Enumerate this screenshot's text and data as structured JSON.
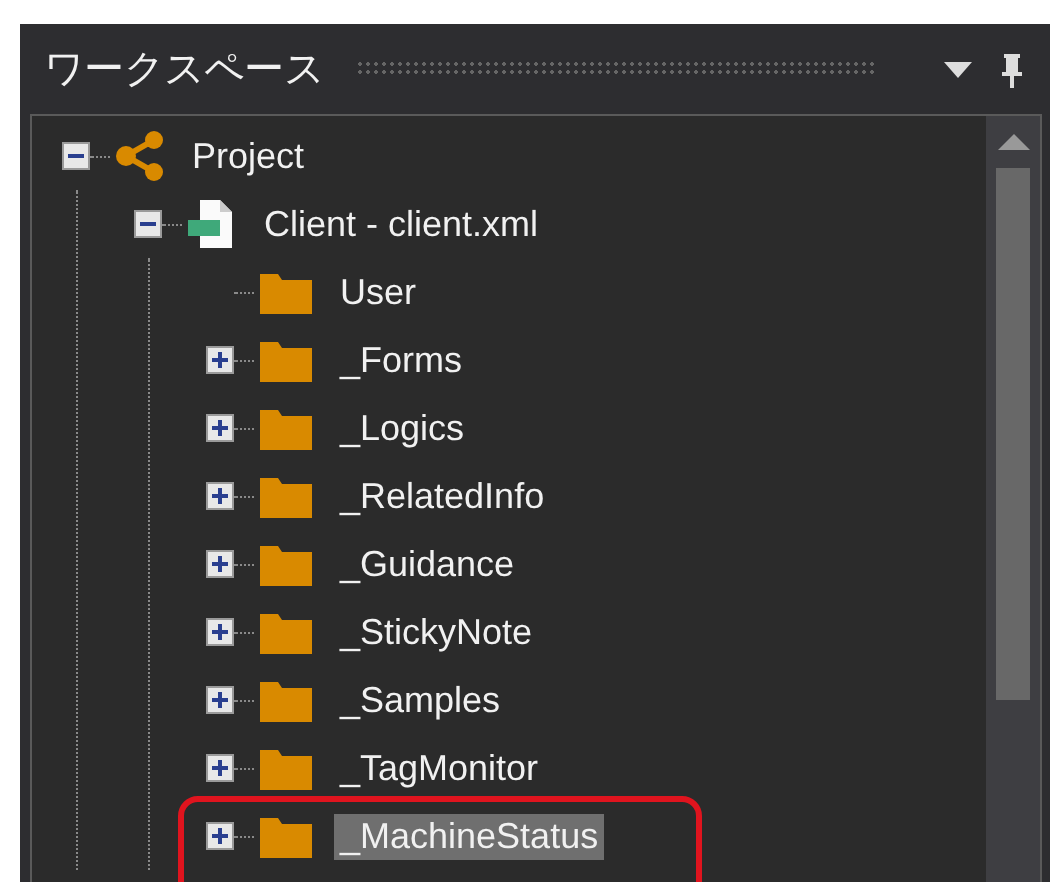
{
  "panel": {
    "title": "ワークスペース"
  },
  "tree": [
    {
      "label": "Project",
      "kind": "project",
      "expanded": true,
      "selected": false,
      "highlighted": false,
      "children": [
        {
          "label": "Client - client.xml",
          "kind": "file",
          "expanded": true,
          "selected": false,
          "highlighted": false,
          "children": [
            {
              "label": "User",
              "kind": "folder",
              "selected": false,
              "highlighted": false
            },
            {
              "label": "_Forms",
              "kind": "folder",
              "expanded": false,
              "selected": false,
              "highlighted": false
            },
            {
              "label": "_Logics",
              "kind": "folder",
              "expanded": false,
              "selected": false,
              "highlighted": false
            },
            {
              "label": "_RelatedInfo",
              "kind": "folder",
              "expanded": false,
              "selected": false,
              "highlighted": false
            },
            {
              "label": "_Guidance",
              "kind": "folder",
              "expanded": false,
              "selected": false,
              "highlighted": false
            },
            {
              "label": "_StickyNote",
              "kind": "folder",
              "expanded": false,
              "selected": false,
              "highlighted": false
            },
            {
              "label": "_Samples",
              "kind": "folder",
              "expanded": false,
              "selected": false,
              "highlighted": false
            },
            {
              "label": "_TagMonitor",
              "kind": "folder",
              "expanded": false,
              "selected": false,
              "highlighted": false
            },
            {
              "label": "_MachineStatus",
              "kind": "folder",
              "expanded": false,
              "selected": true,
              "highlighted": true
            }
          ]
        }
      ]
    }
  ]
}
